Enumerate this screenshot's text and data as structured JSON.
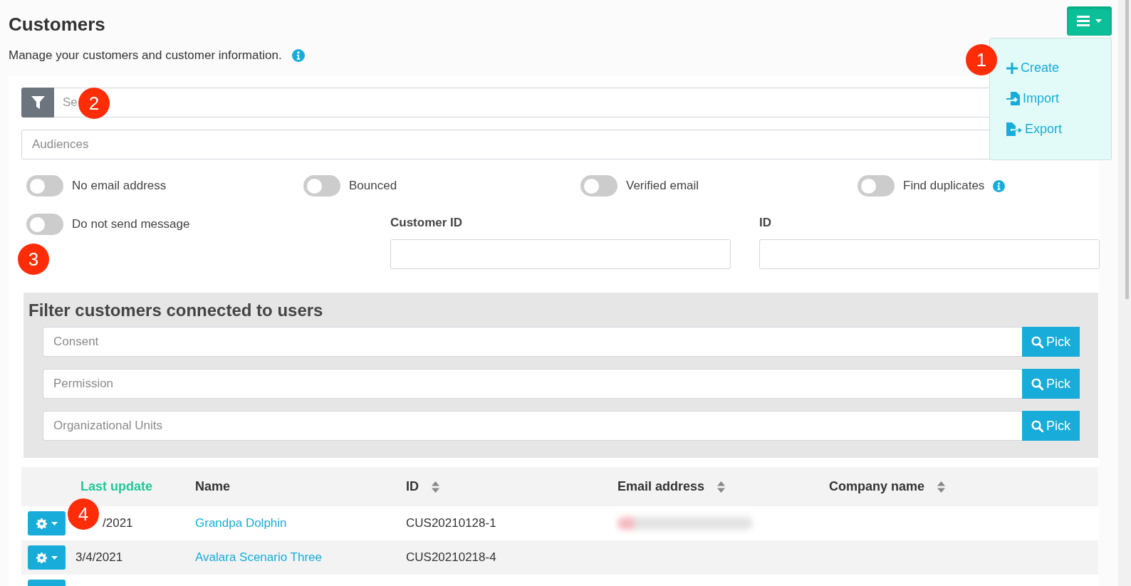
{
  "header": {
    "title": "Customers",
    "subtitle": "Manage your customers and customer information."
  },
  "menu_button": {
    "expanded": true
  },
  "menu": [
    {
      "label": "Create",
      "kind": "create"
    },
    {
      "label": "Import",
      "kind": "import"
    },
    {
      "label": "Export",
      "kind": "export"
    }
  ],
  "search": {
    "placeholder": "Se"
  },
  "audiences": {
    "placeholder": "Audiences"
  },
  "toggles": [
    {
      "label": "No email address",
      "on": false,
      "info": false
    },
    {
      "label": "Bounced",
      "on": false,
      "info": false
    },
    {
      "label": "Verified email",
      "on": false,
      "info": false
    },
    {
      "label": "Find duplicates",
      "on": false,
      "info": true
    },
    {
      "label": "Do not send message",
      "on": false,
      "info": false
    }
  ],
  "id_fields": [
    {
      "label": "Customer ID"
    },
    {
      "label": "ID"
    }
  ],
  "user_filter": {
    "title": "Filter customers connected to users",
    "fields": [
      {
        "placeholder": "Consent",
        "button": "Pick"
      },
      {
        "placeholder": "Permission",
        "button": "Pick"
      },
      {
        "placeholder": "Organizational Units",
        "button": "Pick"
      }
    ]
  },
  "table": {
    "columns": [
      {
        "label": "Last update",
        "sortable": false,
        "active": true
      },
      {
        "label": "Name",
        "sortable": false,
        "active": false
      },
      {
        "label": "ID",
        "sortable": true,
        "active": false
      },
      {
        "label": "Email address",
        "sortable": true,
        "active": false
      },
      {
        "label": "Company name",
        "sortable": true,
        "active": false
      }
    ],
    "rows": [
      {
        "kind": "full",
        "date": "/2021",
        "name": "Grandpa Dolphin",
        "id": "CUS20210128-1",
        "email_blurred": true
      },
      {
        "kind": "full",
        "date": "3/4/2021",
        "name": "Avalara Scenario Three",
        "id": "CUS20210218-4",
        "email_blurred": false
      },
      {
        "kind": "cut"
      }
    ]
  },
  "callouts": [
    "1",
    "2",
    "3",
    "4"
  ]
}
